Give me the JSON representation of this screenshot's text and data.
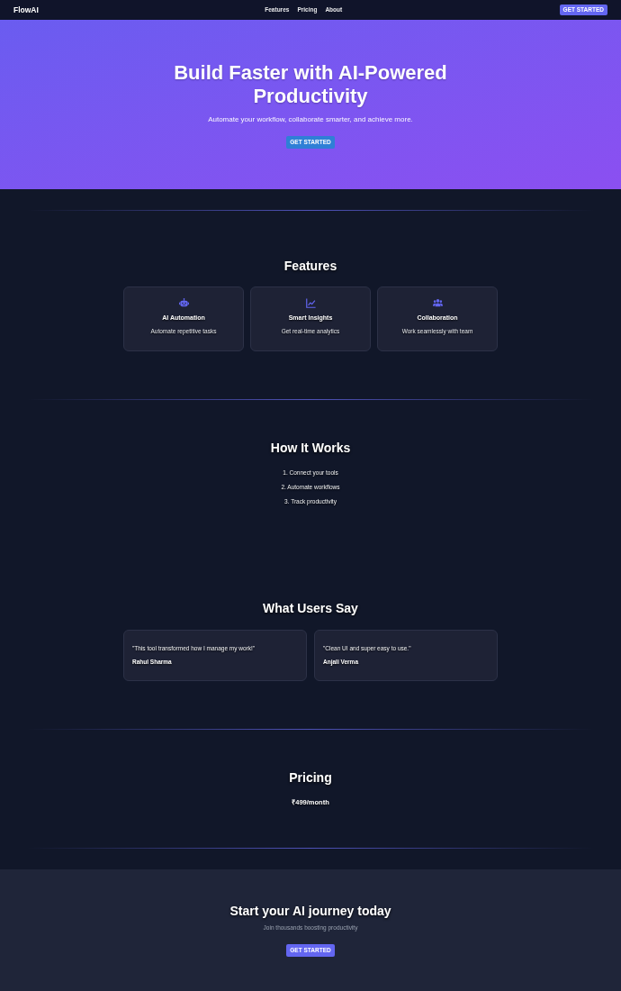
{
  "nav": {
    "logo": "FlowAI",
    "links": [
      "Features",
      "Pricing",
      "About"
    ],
    "button": "GET STARTED"
  },
  "hero": {
    "title": "Build Faster with AI-Powered Productivity",
    "subtitle": "Automate your workflow, collaborate smarter, and achieve more.",
    "button": "GET STARTED"
  },
  "features": {
    "heading": "Features",
    "cards": [
      {
        "title": "AI Automation",
        "text": "Automate repetitive tasks"
      },
      {
        "title": "Smart Insights",
        "text": "Get real-time analytics"
      },
      {
        "title": "Collaboration",
        "text": "Work seamlessly with team"
      }
    ]
  },
  "how_it_works": {
    "heading": "How It Works",
    "steps": [
      "1. Connect your tools",
      "2. Automate workflows",
      "3. Track productivity"
    ]
  },
  "testimonials": {
    "heading": "What Users Say",
    "items": [
      {
        "quote": "\"This tool transformed how I manage my work!\"",
        "name": "Rahul Sharma"
      },
      {
        "quote": "\"Clean UI and super easy to use.\"",
        "name": "Anjali Verma"
      }
    ]
  },
  "pricing": {
    "heading": "Pricing",
    "price": "₹499/month"
  },
  "cta": {
    "heading": "Start your AI journey today",
    "subtitle": "Join thousands boosting productivity",
    "button": "GET STARTED"
  }
}
